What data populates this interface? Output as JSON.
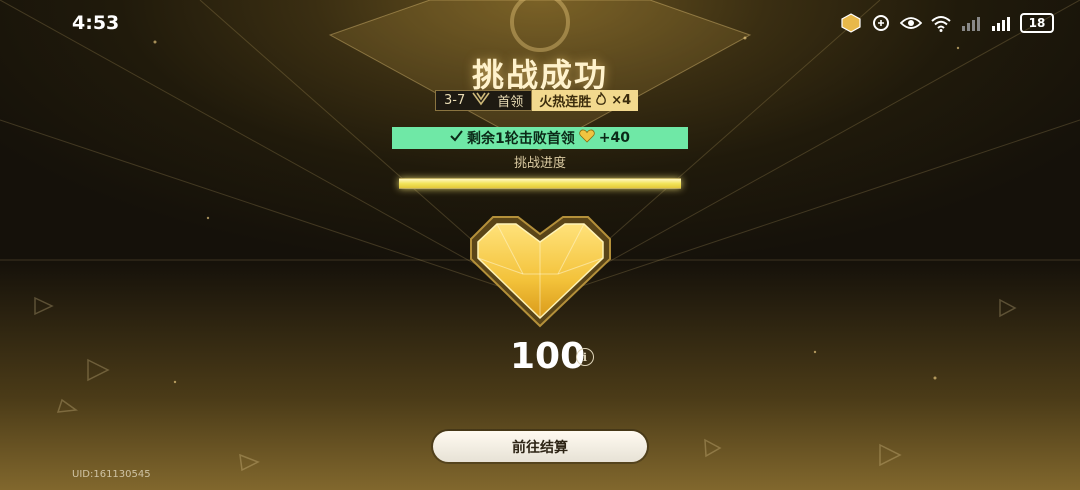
{
  "status_bar": {
    "time": "4:53",
    "battery": "18",
    "icons": [
      "app-notification-icon",
      "data-saver-icon",
      "eye-icon",
      "wifi-icon",
      "signal-icon",
      "signal-icon",
      "battery-icon"
    ]
  },
  "result": {
    "title": "挑战成功",
    "stage": "3-7",
    "boss_label": "首领",
    "streak_label": "火热连胜",
    "streak_count": "×4"
  },
  "bonus": {
    "text": "剩余1轮击败首领",
    "reward": "+40"
  },
  "progress": {
    "label": "挑战进度",
    "fraction": 1.0
  },
  "reward": {
    "icon": "golden-heart-icon",
    "amount": "100"
  },
  "action": {
    "settle_button": "前往结算"
  },
  "footer": {
    "uid": "UID:161130545"
  },
  "colors": {
    "accent_gold": "#f2d98e",
    "bonus_green": "#6fe8a6",
    "progress_yellow": "#f2e45a"
  }
}
